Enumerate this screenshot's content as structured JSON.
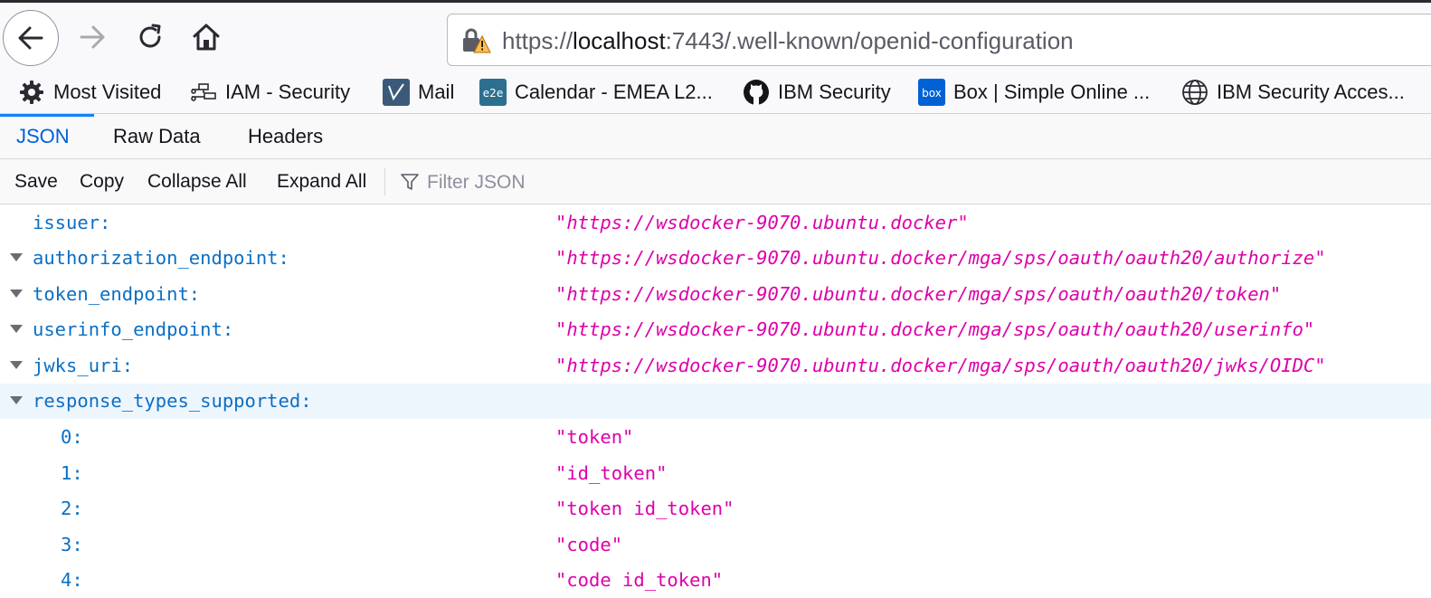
{
  "navbar": {
    "url_prefix": "https://",
    "url_host": "localhost",
    "url_rest": ":7443/.well-known/openid-configuration"
  },
  "bookmarks": [
    {
      "label": "Most Visited",
      "icon": "gear-icon"
    },
    {
      "label": "IAM - Security",
      "icon": "network-icon"
    },
    {
      "label": "Mail",
      "icon": "mail-icon"
    },
    {
      "label": "Calendar - EMEA L2...",
      "icon": "e2e-icon"
    },
    {
      "label": "IBM Security",
      "icon": "github-icon"
    },
    {
      "label": "Box | Simple Online ...",
      "icon": "box-icon"
    },
    {
      "label": "IBM Security Acces...",
      "icon": "globe-icon"
    }
  ],
  "tabs": [
    "JSON",
    "Raw Data",
    "Headers"
  ],
  "actions": {
    "save": "Save",
    "copy": "Copy",
    "collapse_all": "Collapse All",
    "expand_all": "Expand All",
    "filter_placeholder": "Filter JSON"
  },
  "json_rows": [
    {
      "key": "issuer:",
      "value": "\"https://wsdocker-9070.ubuntu.docker\""
    },
    {
      "key": "authorization_endpoint:",
      "value": "\"https://wsdocker-9070.ubuntu.docker/mga/sps/oauth/oauth20/authorize\""
    },
    {
      "key": "token_endpoint:",
      "value": "\"https://wsdocker-9070.ubuntu.docker/mga/sps/oauth/oauth20/token\""
    },
    {
      "key": "userinfo_endpoint:",
      "value": "\"https://wsdocker-9070.ubuntu.docker/mga/sps/oauth/oauth20/userinfo\""
    },
    {
      "key": "jwks_uri:",
      "value": "\"https://wsdocker-9070.ubuntu.docker/mga/sps/oauth/oauth20/jwks/OIDC\""
    },
    {
      "key": "response_types_supported:",
      "value": ""
    },
    {
      "key": "0:",
      "value": "\"token\""
    },
    {
      "key": "1:",
      "value": "\"id_token\""
    },
    {
      "key": "2:",
      "value": "\"token id_token\""
    },
    {
      "key": "3:",
      "value": "\"code\""
    },
    {
      "key": "4:",
      "value": "\"code id_token\""
    }
  ],
  "colors": {
    "key": "#0b6fc5",
    "string": "#dd00a9",
    "selected_tab": "#0060df",
    "selected_row": "#eef6fd"
  }
}
